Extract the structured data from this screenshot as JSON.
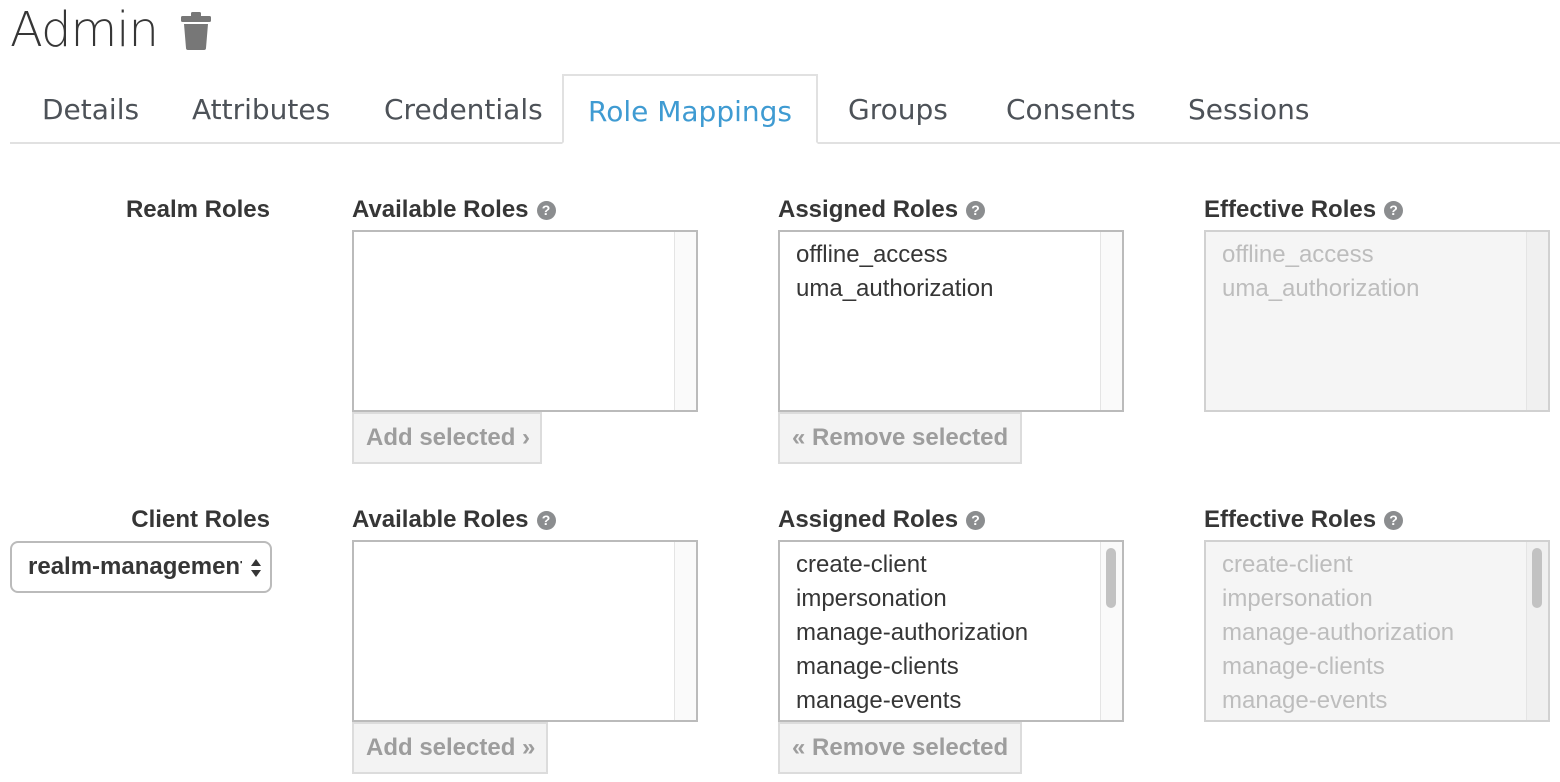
{
  "header": {
    "title": "Admin",
    "trash_icon": "trash-icon"
  },
  "tabs": [
    {
      "label": "Details"
    },
    {
      "label": "Attributes"
    },
    {
      "label": "Credentials"
    },
    {
      "label": "Role Mappings",
      "active": true
    },
    {
      "label": "Groups"
    },
    {
      "label": "Consents"
    },
    {
      "label": "Sessions"
    }
  ],
  "realm": {
    "section_label": "Realm Roles",
    "available": {
      "label": "Available Roles",
      "help_icon": "question-circle-icon",
      "items": [],
      "button": "Add selected ›"
    },
    "assigned": {
      "label": "Assigned Roles",
      "help_icon": "question-circle-icon",
      "items": [
        "offline_access",
        "uma_authorization"
      ],
      "button": "« Remove selected"
    },
    "effective": {
      "label": "Effective Roles",
      "help_icon": "question-circle-icon",
      "items": [
        "offline_access",
        "uma_authorization"
      ]
    }
  },
  "client": {
    "section_label": "Client Roles",
    "select_value": "realm-management",
    "available": {
      "label": "Available Roles",
      "help_icon": "question-circle-icon",
      "items": [],
      "button": "Add selected »"
    },
    "assigned": {
      "label": "Assigned Roles",
      "help_icon": "question-circle-icon",
      "items": [
        "create-client",
        "impersonation",
        "manage-authorization",
        "manage-clients",
        "manage-events"
      ],
      "button": "« Remove selected"
    },
    "effective": {
      "label": "Effective Roles",
      "help_icon": "question-circle-icon",
      "items": [
        "create-client",
        "impersonation",
        "manage-authorization",
        "manage-clients",
        "manage-events"
      ]
    }
  },
  "colors": {
    "accent": "#3f9bd2",
    "text": "#363636",
    "muted": "#bdbdbd"
  }
}
